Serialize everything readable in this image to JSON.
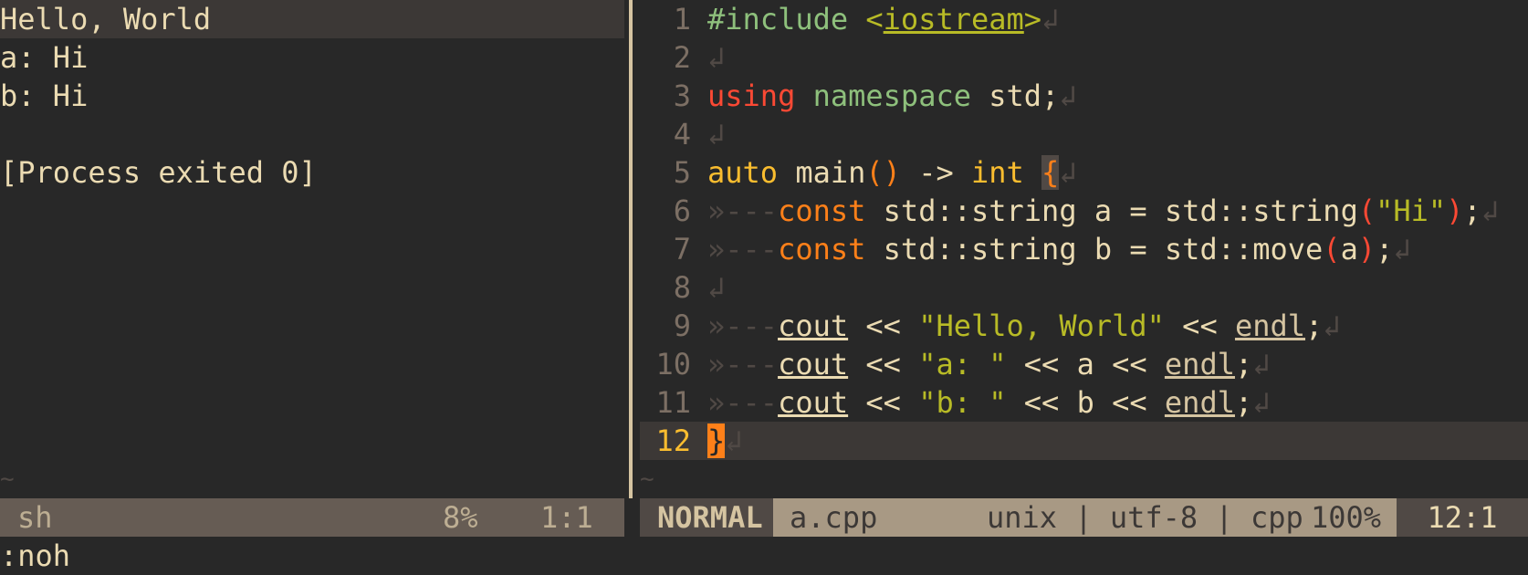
{
  "terminal": {
    "lines": [
      "Hello, World",
      "a: Hi",
      "b: Hi",
      "",
      "[Process exited 0]"
    ],
    "tilde": "~",
    "status": {
      "name": "sh",
      "percent": "8%",
      "position": "1:1"
    }
  },
  "editor": {
    "line_numbers": [
      "1",
      "2",
      "3",
      "4",
      "5",
      "6",
      "7",
      "8",
      "9",
      "10",
      "11",
      "12"
    ],
    "newline_glyph": "↲",
    "tab_glyph": "»---",
    "tilde": "~",
    "code": {
      "l1_pp": "#include",
      "l1_lt": "<",
      "l1_header": "iostream",
      "l1_gt": ">",
      "l3_using": "using",
      "l3_namespace": "namespace",
      "l3_rest": " std;",
      "l5_auto": "auto",
      "l5_main": " main",
      "l5_paren": "()",
      "l5_arrow": " -> ",
      "l5_int": "int",
      "l5_brace": "{",
      "l6_const": "const",
      "l6_mid": " std::string a = std::string",
      "l6_lp": "(",
      "l6_str": "\"Hi\"",
      "l6_rp": ")",
      "l6_end": ";",
      "l7_const": "const",
      "l7_mid": " std::string b = std::move",
      "l7_lp": "(",
      "l7_arg": "a",
      "l7_rp": ")",
      "l7_end": ";",
      "l9_cout": "cout",
      "l9_op1": " << ",
      "l9_str": "\"Hello, World\"",
      "l9_op2": " << ",
      "l9_endl": "endl",
      "l9_end": ";",
      "l10_cout": "cout",
      "l10_op1": " << ",
      "l10_str": "\"a: \"",
      "l10_mid": " << a << ",
      "l10_endl": "endl",
      "l10_end": ";",
      "l11_cout": "cout",
      "l11_op1": " << ",
      "l11_str": "\"b: \"",
      "l11_mid": " << b << ",
      "l11_endl": "endl",
      "l11_end": ";",
      "l12_brace": "}"
    },
    "status": {
      "mode": "NORMAL",
      "filename": "a.cpp",
      "fileinfo": "unix | utf-8 | cpp",
      "percent": "100%",
      "position": "12:1"
    }
  },
  "cmdline": ":noh",
  "colors": {
    "background": "#282828",
    "cursorline": "#3c3836",
    "keyword": "#fb4934",
    "string": "#b8bb26",
    "type": "#fabd2f",
    "accent": "#fe8019"
  }
}
